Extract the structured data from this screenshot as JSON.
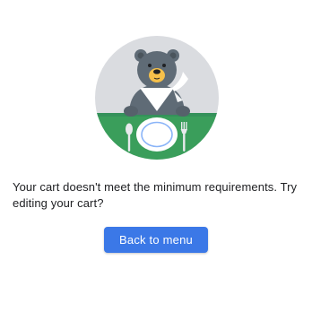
{
  "message": {
    "text": "Your cart doesn't meet the minimum requirements. Try editing your cart?"
  },
  "actions": {
    "back_to_menu_label": "Back to menu"
  },
  "illustration": {
    "subject": "bear-at-table-illustration"
  },
  "colors": {
    "primary_button": "#3b78e7",
    "circle_background": "#dadce0",
    "tablecloth": "#3a9e5b",
    "bear_fur": "#5f6b76",
    "text": "#202124"
  }
}
